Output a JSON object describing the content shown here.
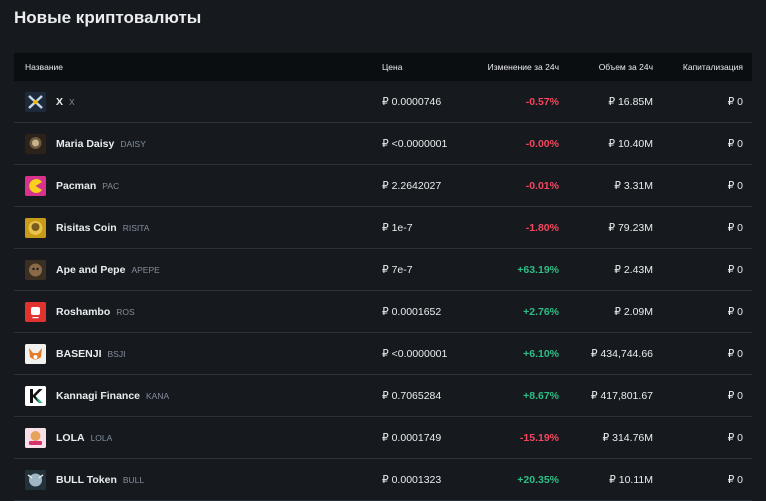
{
  "page": {
    "title": "Новые криптовалюты"
  },
  "headers": {
    "name": "Название",
    "price": "Цена",
    "change": "Изменение за 24ч",
    "volume": "Объем за 24ч",
    "cap": "Капитализация"
  },
  "rows": [
    {
      "name": "X",
      "symbol": "X",
      "price": "₽ 0.0000746",
      "change": "-0.57%",
      "volume": "₽ 16.85M",
      "cap": "₽ 0",
      "logo_icon": "x-token-icon"
    },
    {
      "name": "Maria Daisy",
      "symbol": "DAISY",
      "price": "₽ <0.0000001",
      "change": "-0.00%",
      "volume": "₽ 10.40M",
      "cap": "₽ 0",
      "logo_icon": "daisy-token-icon"
    },
    {
      "name": "Pacman",
      "symbol": "PAC",
      "price": "₽ 2.2642027",
      "change": "-0.01%",
      "volume": "₽ 3.31M",
      "cap": "₽ 0",
      "logo_icon": "pacman-token-icon"
    },
    {
      "name": "Risitas Coin",
      "symbol": "RISITA",
      "price": "₽ 1e-7",
      "change": "-1.80%",
      "volume": "₽ 79.23M",
      "cap": "₽ 0",
      "logo_icon": "risita-token-icon"
    },
    {
      "name": "Ape and Pepe",
      "symbol": "APEPE",
      "price": "₽ 7e-7",
      "change": "+63.19%",
      "volume": "₽ 2.43M",
      "cap": "₽ 0",
      "logo_icon": "apepe-token-icon"
    },
    {
      "name": "Roshambo",
      "symbol": "ROS",
      "price": "₽ 0.0001652",
      "change": "+2.76%",
      "volume": "₽ 2.09M",
      "cap": "₽ 0",
      "logo_icon": "roshambo-token-icon"
    },
    {
      "name": "BASENJI",
      "symbol": "BSJI",
      "price": "₽ <0.0000001",
      "change": "+6.10%",
      "volume": "₽ 434,744.66",
      "cap": "₽ 0",
      "logo_icon": "basenji-token-icon"
    },
    {
      "name": "Kannagi Finance",
      "symbol": "KANA",
      "price": "₽ 0.7065284",
      "change": "+8.67%",
      "volume": "₽ 417,801.67",
      "cap": "₽ 0",
      "logo_icon": "kana-token-icon"
    },
    {
      "name": "LOLA",
      "symbol": "LOLA",
      "price": "₽ 0.0001749",
      "change": "-15.19%",
      "volume": "₽ 314.76M",
      "cap": "₽ 0",
      "logo_icon": "lola-token-icon"
    },
    {
      "name": "BULL Token",
      "symbol": "BULL",
      "price": "₽ 0.0001323",
      "change": "+20.35%",
      "volume": "₽ 10.11M",
      "cap": "₽ 0",
      "logo_icon": "bull-token-icon"
    }
  ],
  "colors": {
    "positive": "#2ebd85",
    "negative": "#f6465d",
    "background": "#161a1e",
    "header_bg": "#0b0e11"
  }
}
